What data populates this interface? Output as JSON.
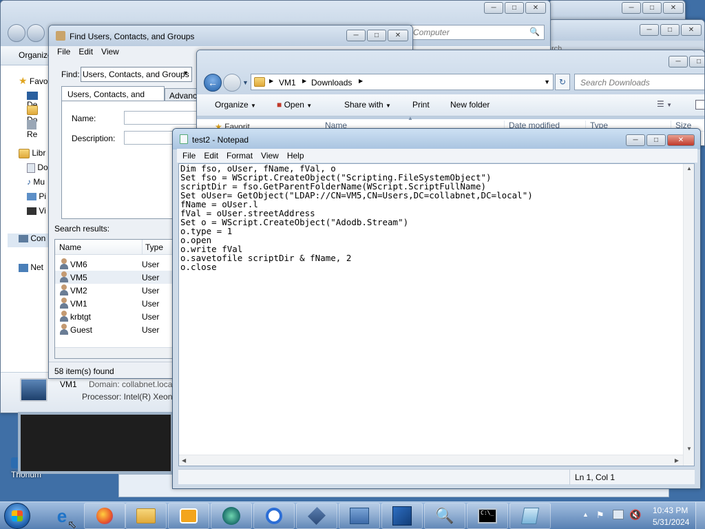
{
  "desktop": {
    "icon_label": "Thorium"
  },
  "back_windows": {
    "computer_search_placeholder": "Computer",
    "search_fragment": "rch"
  },
  "explorer_left": {
    "organize": "Organize",
    "favorites": "Favo",
    "fav_items": [
      "De",
      "Do",
      "Re"
    ],
    "libraries": "Libr",
    "lib_items": [
      "Do",
      "Mu",
      "Pi",
      "Vi"
    ],
    "computer": "Con",
    "network": "Net",
    "details_name": "VM1",
    "details_domain": "Domain: collabnet.loca",
    "details_processor": "Processor: Intel(R) Xeon("
  },
  "find_dialog": {
    "title": "Find Users, Contacts, and Groups",
    "menu": [
      "File",
      "Edit",
      "View"
    ],
    "find_label": "Find:",
    "find_value": "Users, Contacts, and Groups",
    "tabs": [
      "Users, Contacts, and Groups",
      "Advance"
    ],
    "name_label": "Name:",
    "description_label": "Description:",
    "results_label": "Search results:",
    "columns": [
      "Name",
      "Type"
    ],
    "rows": [
      {
        "name": "VM6",
        "type": "User"
      },
      {
        "name": "VM5",
        "type": "User"
      },
      {
        "name": "VM2",
        "type": "User"
      },
      {
        "name": "VM1",
        "type": "User"
      },
      {
        "name": "krbtgt",
        "type": "User"
      },
      {
        "name": "Guest",
        "type": "User"
      }
    ],
    "status": "58 item(s) found"
  },
  "downloads": {
    "breadcrumb": [
      "VM1",
      "Downloads"
    ],
    "search_placeholder": "Search Downloads",
    "toolbar": {
      "organize": "Organize",
      "open": "Open",
      "share_with": "Share with",
      "print": "Print",
      "new_folder": "New folder"
    },
    "columns": [
      "Name",
      "Date modified",
      "Type",
      "Size"
    ],
    "fav_fragment": "Favorit"
  },
  "notepad": {
    "title": "test2 - Notepad",
    "menu": [
      "File",
      "Edit",
      "Format",
      "View",
      "Help"
    ],
    "lines": [
      "Dim fso, oUser, fName, fVal, o",
      "Set fso = WScript.CreateObject(\"Scripting.FileSystemObject\")",
      "scriptDir = fso.GetParentFolderName(WScript.ScriptFullName)",
      "Set oUser= GetObject(\"LDAP://CN=VM5,CN=Users,DC=collabnet,DC=local\")",
      "fName = oUser.l",
      "fVal = oUser.streetAddress",
      "Set o = WScript.CreateObject(\"Adodb.Stream\")",
      "o.type = 1",
      "o.open",
      "o.write fVal",
      "o.savetofile scriptDir & fName, 2",
      "o.close"
    ],
    "status": "Ln 1, Col 1"
  },
  "taskbar": {
    "time": "10:43 PM",
    "date": "5/31/2024"
  }
}
